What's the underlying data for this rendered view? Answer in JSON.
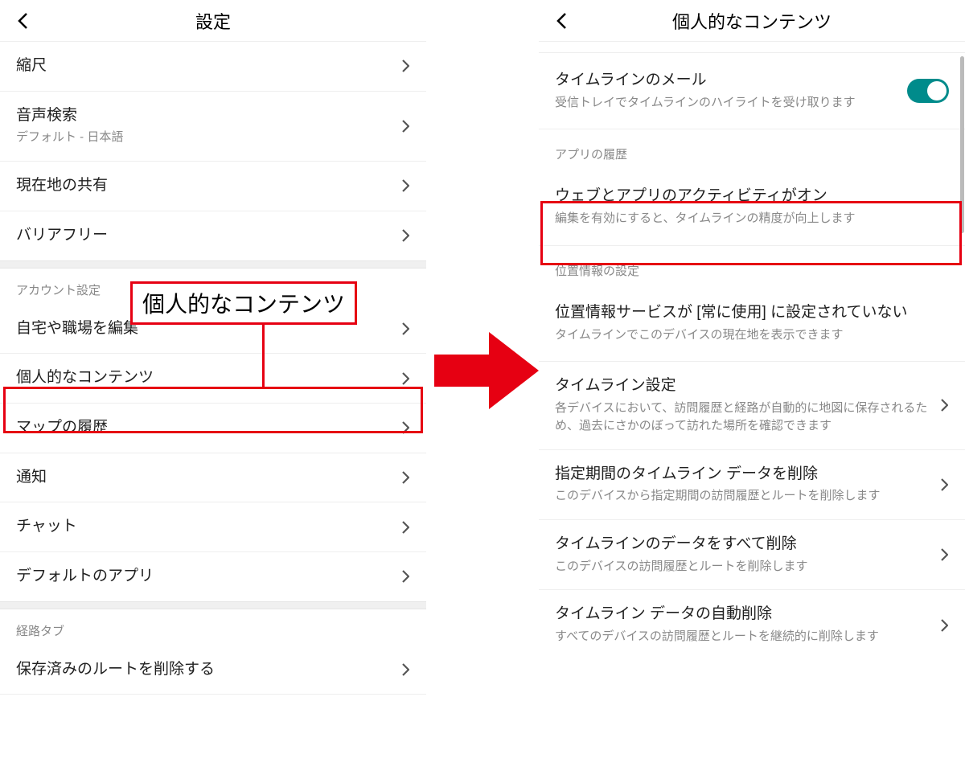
{
  "left": {
    "title": "設定",
    "items": [
      {
        "title": "縮尺"
      },
      {
        "title": "音声検索",
        "sub": "デフォルト - 日本語"
      },
      {
        "title": "現在地の共有"
      },
      {
        "title": "バリアフリー"
      }
    ],
    "section_account": "アカウント設定",
    "account_items": [
      {
        "title": "自宅や職場を編集"
      },
      {
        "title": "個人的なコンテンツ"
      },
      {
        "title": "マップの履歴"
      },
      {
        "title": "通知"
      },
      {
        "title": "チャット"
      },
      {
        "title": "デフォルトのアプリ"
      }
    ],
    "section_route": "経路タブ",
    "route_items": [
      {
        "title": "保存済みのルートを削除する"
      }
    ]
  },
  "right": {
    "title": "個人的なコンテンツ",
    "timeline_mail": {
      "title": "タイムラインのメール",
      "sub": "受信トレイでタイムラインのハイライトを受け取ります"
    },
    "section_app_history": "アプリの履歴",
    "web_activity": {
      "title": "ウェブとアプリのアクティビティがオン",
      "sub": "編集を有効にすると、タイムラインの精度が向上します"
    },
    "section_location": "位置情報の設定",
    "location_items": [
      {
        "title": "位置情報サービスが [常に使用] に設定されていない",
        "sub": "タイムラインでこのデバイスの現在地を表示できます",
        "chev": false
      },
      {
        "title": "タイムライン設定",
        "sub": "各デバイスにおいて、訪問履歴と経路が自動的に地図に保存されるため、過去にさかのぼって訪れた場所を確認できます",
        "chev": true
      },
      {
        "title": "指定期間のタイムライン データを削除",
        "sub": "このデバイスから指定期間の訪問履歴とルートを削除します",
        "chev": true
      },
      {
        "title": "タイムラインのデータをすべて削除",
        "sub": "このデバイスの訪問履歴とルートを削除します",
        "chev": true
      },
      {
        "title": "タイムライン データの自動削除",
        "sub": "すべてのデバイスの訪問履歴とルートを継続的に削除します",
        "chev": true
      }
    ]
  },
  "callout_label": "個人的なコンテンツ"
}
